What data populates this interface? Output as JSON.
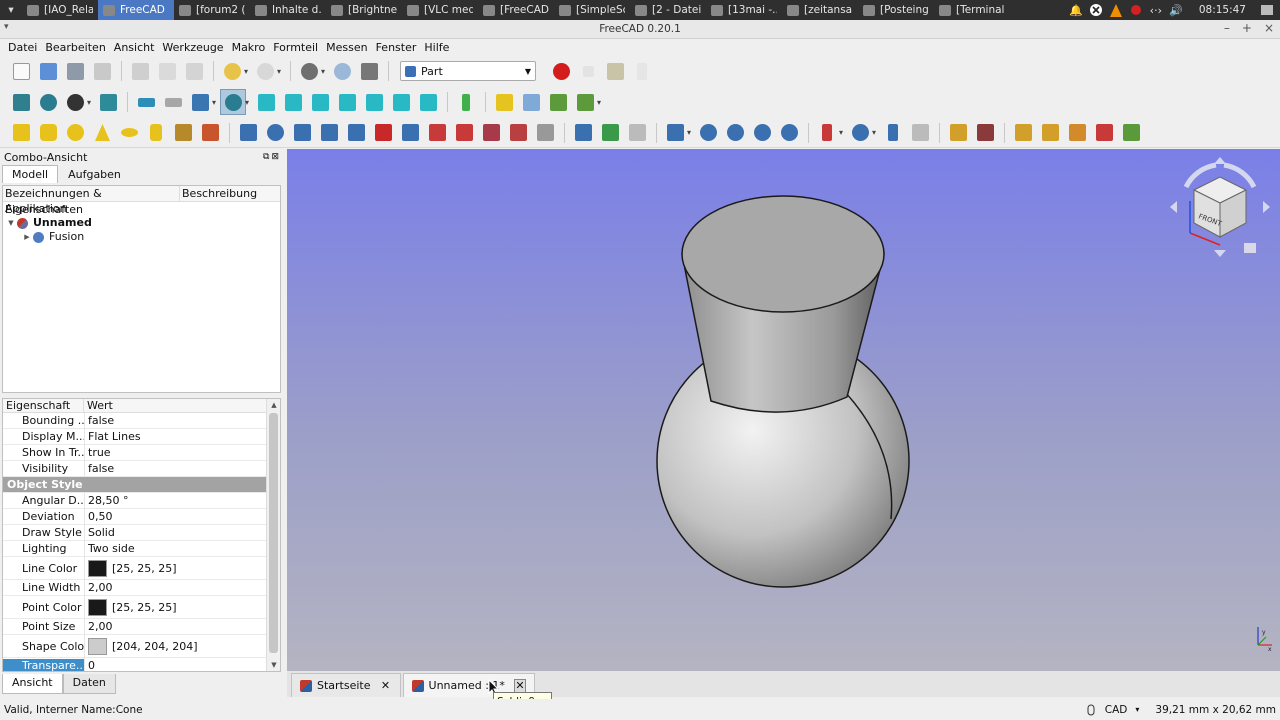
{
  "taskbar": {
    "tasks": [
      {
        "label": "[IAO_Rela...",
        "active": false
      },
      {
        "label": "FreeCAD ...",
        "active": true
      },
      {
        "label": "[forum2 (...",
        "active": false
      },
      {
        "label": "Inhalte d...",
        "active": false
      },
      {
        "label": "[Brightne...",
        "active": false
      },
      {
        "label": "[VLC med...",
        "active": false
      },
      {
        "label": "[FreeCAD...",
        "active": false
      },
      {
        "label": "[SimpleSc...",
        "active": false
      },
      {
        "label": "[2 - Datei...",
        "active": false
      },
      {
        "label": "[13mai -...",
        "active": false
      },
      {
        "label": "[zeitansa...",
        "active": false
      },
      {
        "label": "[Posteing...",
        "active": false
      },
      {
        "label": "[Terminal ...",
        "active": false
      }
    ],
    "clock": "08:15:47"
  },
  "window": {
    "title": "FreeCAD 0.20.1"
  },
  "menu": [
    "Datei",
    "Bearbeiten",
    "Ansicht",
    "Werkzeuge",
    "Makro",
    "Formteil",
    "Messen",
    "Fenster",
    "Hilfe"
  ],
  "workbench": {
    "selected": "Part"
  },
  "combo": {
    "title": "Combo-Ansicht",
    "tabs": [
      {
        "label": "Modell",
        "active": true
      },
      {
        "label": "Aufgaben",
        "active": false
      }
    ],
    "tree_headers": [
      "Bezeichnungen & Eigenschaften",
      "Beschreibung"
    ],
    "tree": {
      "root": "Applikation",
      "document": "Unnamed",
      "child": "Fusion"
    },
    "props_headers": [
      "Eigenschaft",
      "Wert"
    ],
    "props": [
      {
        "key": "Bounding ...",
        "value": "false"
      },
      {
        "key": "Display M...",
        "value": "Flat Lines"
      },
      {
        "key": "Show In Tr...",
        "value": "true"
      },
      {
        "key": "Visibility",
        "value": "false"
      },
      {
        "group": "Object Style"
      },
      {
        "key": "Angular D...",
        "value": "28,50 °"
      },
      {
        "key": "Deviation",
        "value": "0,50"
      },
      {
        "key": "Draw Style",
        "value": "Solid"
      },
      {
        "key": "Lighting",
        "value": "Two side"
      },
      {
        "key": "Line Color",
        "value": "[25, 25, 25]",
        "color": "#191919"
      },
      {
        "key": "Line Width",
        "value": "2,00"
      },
      {
        "key": "Point Color",
        "value": "[25, 25, 25]",
        "color": "#191919"
      },
      {
        "key": "Point Size",
        "value": "2,00"
      },
      {
        "key": "Shape Color",
        "value": "[204, 204, 204]",
        "color": "#cccccc"
      },
      {
        "key": "Transpare...",
        "value": "0",
        "selected": true
      }
    ],
    "bottom_tabs": [
      {
        "label": "Ansicht",
        "active": true
      },
      {
        "label": "Daten",
        "active": false
      }
    ]
  },
  "navcube": {
    "face_label": "FRONT"
  },
  "doc_tabs": [
    {
      "label": "Startseite",
      "active": false
    },
    {
      "label": "Unnamed : 1*",
      "active": true
    }
  ],
  "tooltip": "Schließen",
  "status": {
    "message": "Valid, Interner Name:Cone",
    "nav_style": "CAD",
    "dimensions": "39,21 mm x 20,62 mm"
  },
  "colors": {
    "accent": "#4a78c2",
    "selection": "#3d8ec9",
    "viewport_top": "#7a7fe8",
    "viewport_bottom": "#b4b4c2"
  }
}
